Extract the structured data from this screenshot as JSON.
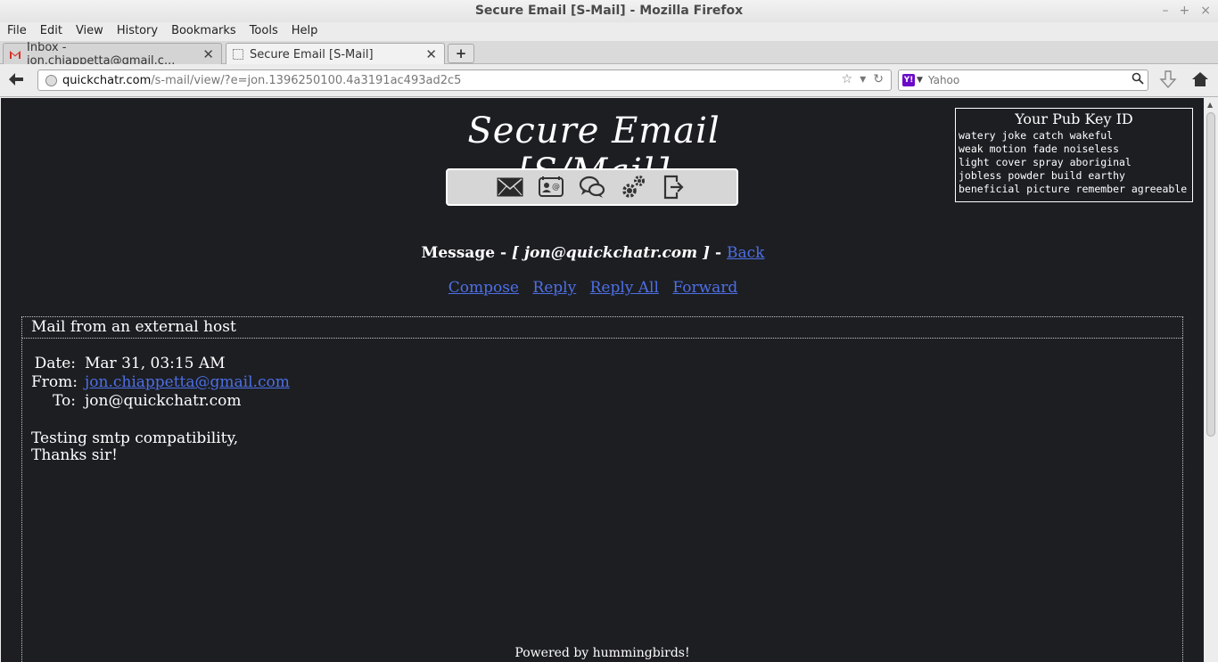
{
  "window": {
    "title": "Secure Email [S-Mail] - Mozilla Firefox"
  },
  "menu": [
    "File",
    "Edit",
    "View",
    "History",
    "Bookmarks",
    "Tools",
    "Help"
  ],
  "tabs": [
    {
      "label": "Inbox - jon.chiappetta@gmail.c...",
      "icon": "gmail-icon"
    },
    {
      "label": "Secure Email [S-Mail]",
      "icon": "blank-page-icon"
    }
  ],
  "urlbar": {
    "host": "quickchatr.com",
    "path": "/s-mail/view/?e=jon.1396250100.4a3191ac493ad2c5"
  },
  "search": {
    "engine": "Yahoo",
    "placeholder": "Yahoo"
  },
  "site": {
    "title": "Secure Email [S/Mail]"
  },
  "pubkey": {
    "title": "Your Pub Key ID",
    "lines": [
      "watery joke catch wakeful",
      "weak motion fade noiseless",
      "light cover spray aboriginal",
      "jobless powder build earthy",
      "beneficial picture remember agreeable"
    ]
  },
  "message": {
    "label": "Message - ",
    "address": "[ jon@quickchatr.com ]",
    "sep": " - ",
    "back": "Back"
  },
  "actions": {
    "compose": "Compose",
    "reply": "Reply",
    "reply_all": "Reply All",
    "forward": "Forward"
  },
  "mail": {
    "header": "Mail from an external host",
    "date_label": "Date:",
    "date": "Mar 31, 03:15 AM",
    "from_label": "From:",
    "from": "jon.chiappetta@gmail.com",
    "to_label": "To:",
    "to": "jon@quickchatr.com",
    "body_line1": "Testing smtp compatibility,",
    "body_line2": "Thanks sir!"
  },
  "footer": "Powered by hummingbirds!"
}
